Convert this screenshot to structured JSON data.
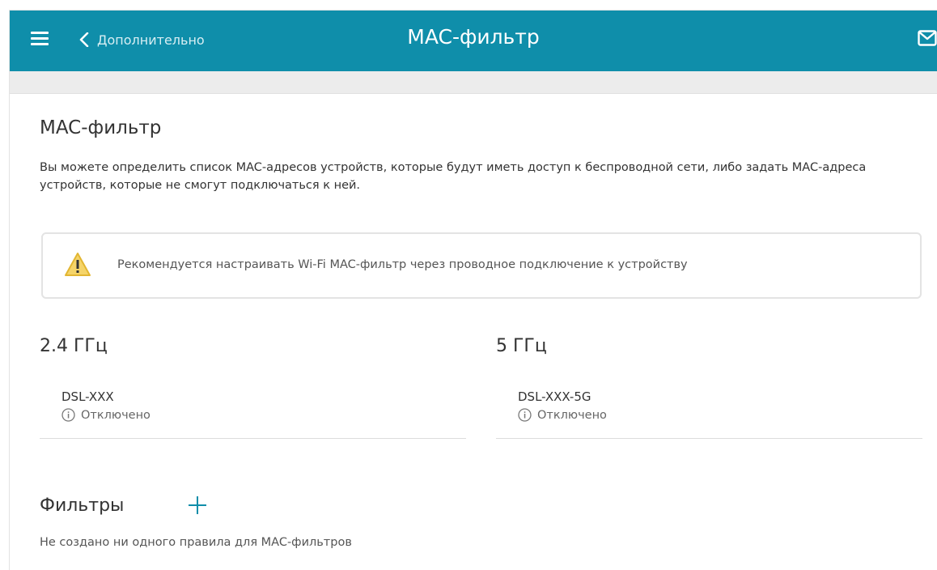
{
  "header": {
    "back_label": "Дополнительно",
    "title": "MAC-фильтр",
    "menu_icon": "hamburger-icon",
    "back_icon": "chevron-left-icon",
    "mail_icon": "mail-icon",
    "background_color": "#0f8eaa"
  },
  "main": {
    "heading": "MAC-фильтр",
    "description": "Вы можете определить список MAC-адресов устройств, которые будут иметь доступ к беспроводной сети, либо задать MAC-адреса устройств, которые не смогут подключаться к ней.",
    "warning": {
      "icon": "warning-icon",
      "text": "Рекомендуется настраивать Wi-Fi MAC-фильтр через проводное подключение к устройству"
    },
    "bands": [
      {
        "title": "2.4 ГГц",
        "network_name": "DSL-XXX",
        "status": "Отключено",
        "status_icon": "info-icon"
      },
      {
        "title": "5 ГГц",
        "network_name": "DSL-XXX-5G",
        "status": "Отключено",
        "status_icon": "info-icon"
      }
    ],
    "filters": {
      "title": "Фильтры",
      "add_icon": "plus-icon",
      "empty_text": "Не создано ни одного правила для MAC-фильтров"
    }
  }
}
